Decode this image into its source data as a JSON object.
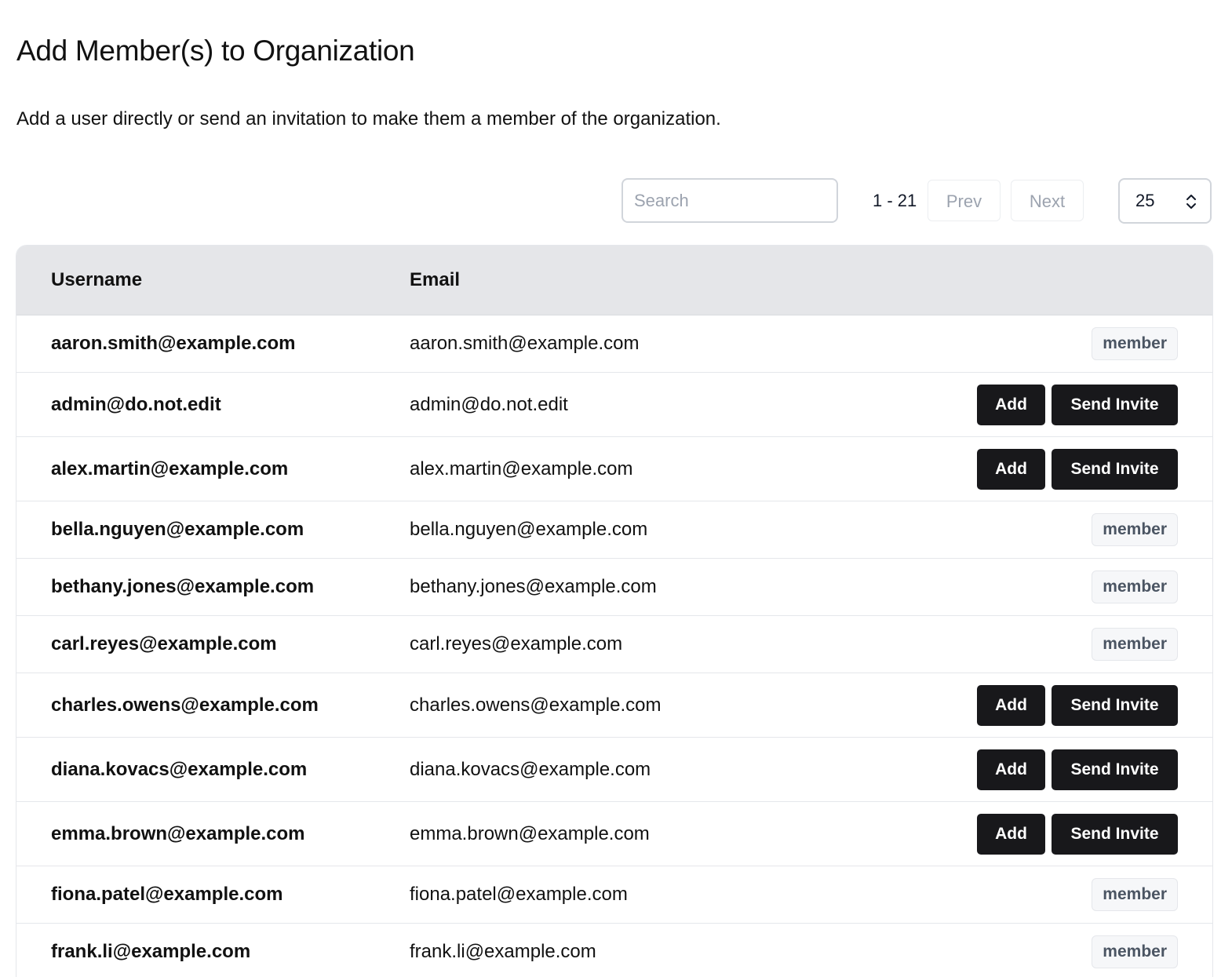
{
  "header": {
    "title": "Add Member(s) to Organization",
    "description": "Add a user directly or send an invitation to make them a member of the organization."
  },
  "toolbar": {
    "search_placeholder": "Search",
    "search_value": "",
    "range_text": "1 - 21",
    "prev_label": "Prev",
    "next_label": "Next",
    "per_page_value": "25",
    "per_page_icon": "chevron-up-down-icon"
  },
  "table": {
    "columns": {
      "username": "Username",
      "email": "Email"
    },
    "rows": [
      {
        "username": "aaron.smith@example.com",
        "email": "aaron.smith@example.com",
        "status": "member"
      },
      {
        "username": "admin@do.not.edit",
        "email": "admin@do.not.edit",
        "status": "add",
        "add_label": "Add",
        "invite_label": "Send Invite"
      },
      {
        "username": "alex.martin@example.com",
        "email": "alex.martin@example.com",
        "status": "add",
        "add_label": "Add",
        "invite_label": "Send Invite"
      },
      {
        "username": "bella.nguyen@example.com",
        "email": "bella.nguyen@example.com",
        "status": "member"
      },
      {
        "username": "bethany.jones@example.com",
        "email": "bethany.jones@example.com",
        "status": "member"
      },
      {
        "username": "carl.reyes@example.com",
        "email": "carl.reyes@example.com",
        "status": "member"
      },
      {
        "username": "charles.owens@example.com",
        "email": "charles.owens@example.com",
        "status": "add",
        "add_label": "Add",
        "invite_label": "Send Invite"
      },
      {
        "username": "diana.kovacs@example.com",
        "email": "diana.kovacs@example.com",
        "status": "add",
        "add_label": "Add",
        "invite_label": "Send Invite"
      },
      {
        "username": "emma.brown@example.com",
        "email": "emma.brown@example.com",
        "status": "add",
        "add_label": "Add",
        "invite_label": "Send Invite"
      },
      {
        "username": "fiona.patel@example.com",
        "email": "fiona.patel@example.com",
        "status": "member"
      },
      {
        "username": "frank.li@example.com",
        "email": "frank.li@example.com",
        "status": "member"
      }
    ],
    "member_badge_label": "member"
  }
}
